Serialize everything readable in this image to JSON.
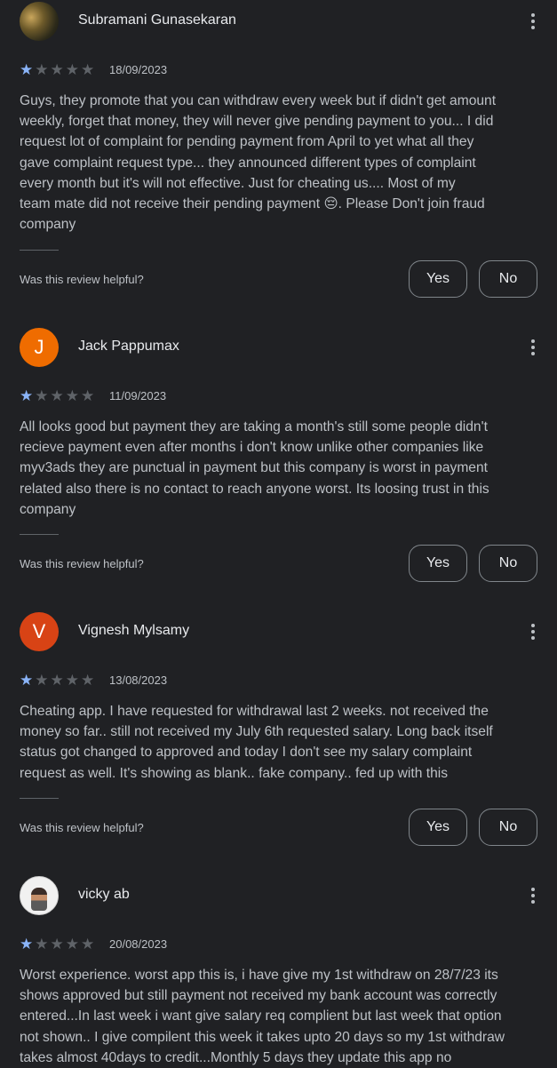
{
  "reviews": [
    {
      "name": "Subramani Gunasekaran",
      "avatar": {
        "type": "photo",
        "icon": "profile-photo"
      },
      "stars": 1,
      "max_stars": 5,
      "date": "18/09/2023",
      "text": "Guys, they promote that you can withdraw every week but if didn't get amount\nweekly, forget that money, they will never give pending payment to you... I did\nrequest lot of complaint for pending payment from April to yet what all they\ngave complaint request type... they announced different types of complaint\nevery month but it's will not effective. Just for cheating us.... Most of my\nteam mate did not receive their pending payment 😔. Please Don't join fraud\ncompany",
      "helpful_label": "Was this review helpful?",
      "yes_label": "Yes",
      "no_label": "No"
    },
    {
      "name": "Jack Pappumax",
      "avatar": {
        "type": "letter",
        "letter": "J",
        "color": "#ef6c00"
      },
      "stars": 1,
      "max_stars": 5,
      "date": "11/09/2023",
      "text": "All looks good but payment they are taking a month's still some people didn't\nrecieve payment even after months i don't know unlike other companies like\nmyv3ads they are punctual in payment but this company is worst in payment\nrelated also there is no contact to reach anyone worst. Its loosing trust in this\ncompany",
      "helpful_label": "Was this review helpful?",
      "yes_label": "Yes",
      "no_label": "No"
    },
    {
      "name": "Vignesh Mylsamy",
      "avatar": {
        "type": "letter",
        "letter": "V",
        "color": "#d84315"
      },
      "stars": 1,
      "max_stars": 5,
      "date": "13/08/2023",
      "text": "Cheating app. I have requested for withdrawal last 2 weeks. not received the\nmoney so far.. still not received my July 6th requested salary. Long back itself\nstatus got changed to approved and today I don't see my salary complaint\nrequest as well. It's showing as blank.. fake company.. fed up with this",
      "helpful_label": "Was this review helpful?",
      "yes_label": "Yes",
      "no_label": "No"
    },
    {
      "name": "vicky ab",
      "avatar": {
        "type": "photo",
        "icon": "profile-photo"
      },
      "stars": 1,
      "max_stars": 5,
      "date": "20/08/2023",
      "text": "Worst experience. worst app this is, i have give my 1st withdraw on 28/7/23 its\nshows approved but still payment not received my bank account was correctly\nentered...In last week i want give salary req complient but last week that option\nnot shown.. I give compilent this week it takes upto 20 days so my 1st withdraw\ntakes almost 40days to credit...Monthly 5 days they update this app no"
    }
  ],
  "colors": {
    "background": "#202124",
    "star_filled": "#8ab4f8",
    "star_empty": "#5f6368",
    "text_primary": "#e8eaed",
    "text_secondary": "#bdc1c6"
  },
  "icons": {
    "more": "more-vert-icon",
    "star": "star-icon"
  }
}
